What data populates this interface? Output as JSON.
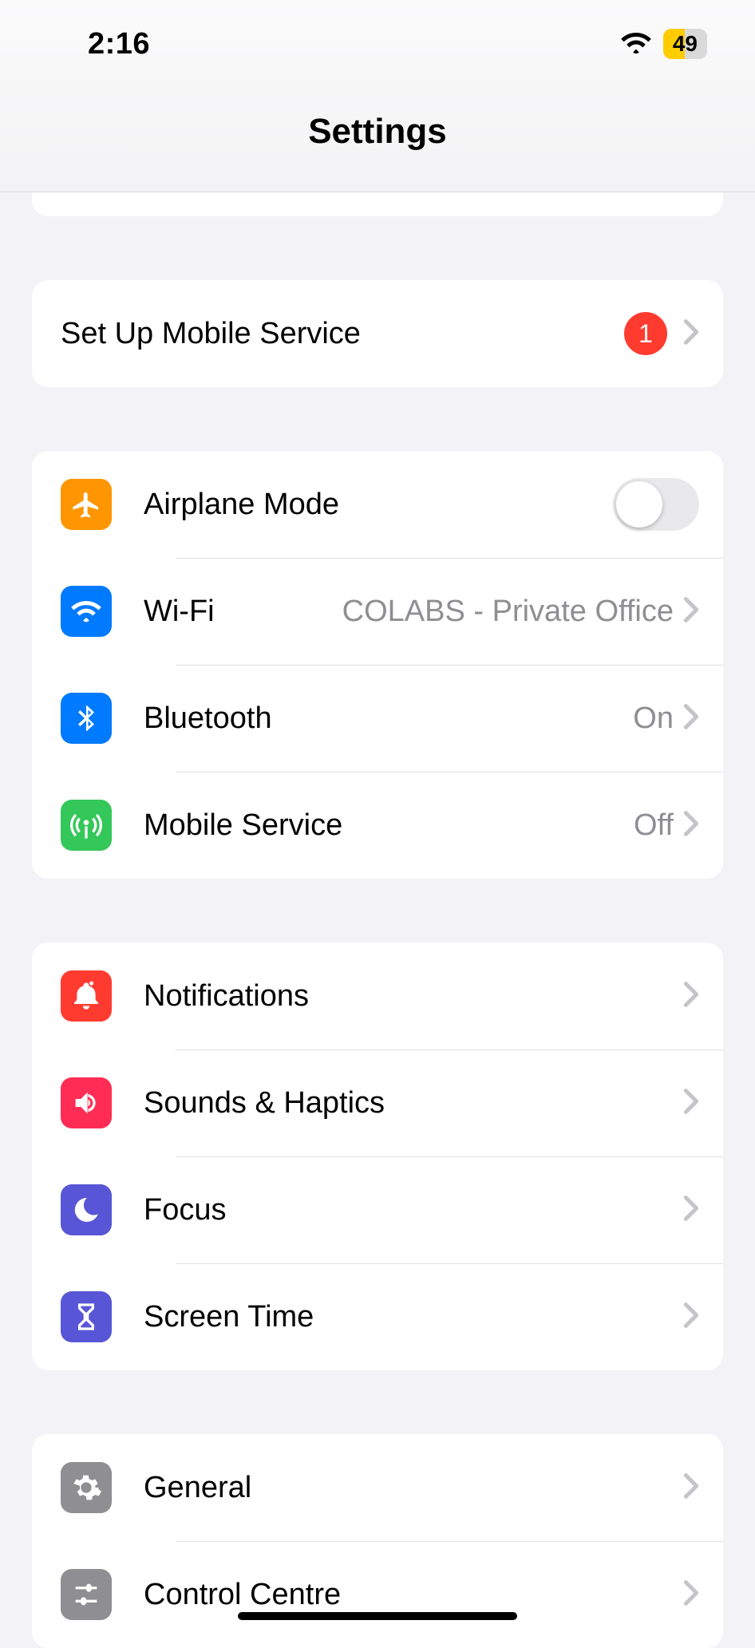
{
  "status": {
    "time": "2:16",
    "battery_pct": "49"
  },
  "title": "Settings",
  "group_mobile_setup": {
    "label": "Set Up Mobile Service",
    "badge": "1"
  },
  "group_connectivity": {
    "airplane": {
      "label": "Airplane Mode",
      "icon_bg": "#ff9500"
    },
    "wifi": {
      "label": "Wi-Fi",
      "detail": "COLABS - Private Office",
      "icon_bg": "#007aff"
    },
    "bluetooth": {
      "label": "Bluetooth",
      "detail": "On",
      "icon_bg": "#007aff"
    },
    "mobile": {
      "label": "Mobile Service",
      "detail": "Off",
      "icon_bg": "#34c759"
    }
  },
  "group_alerts": {
    "notifications": {
      "label": "Notifications",
      "icon_bg": "#ff3b30"
    },
    "sounds": {
      "label": "Sounds & Haptics",
      "icon_bg": "#ff2d55"
    },
    "focus": {
      "label": "Focus",
      "icon_bg": "#5856d6"
    },
    "screentime": {
      "label": "Screen Time",
      "icon_bg": "#5856d6"
    }
  },
  "group_general": {
    "general": {
      "label": "General",
      "icon_bg": "#8e8e93"
    },
    "control_centre": {
      "label": "Control Centre",
      "icon_bg": "#8e8e93"
    }
  }
}
